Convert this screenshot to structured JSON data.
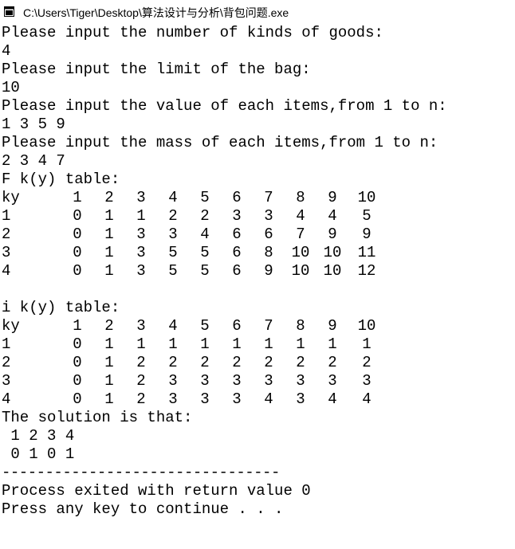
{
  "window": {
    "title": "C:\\Users\\Tiger\\Desktop\\算法设计与分析\\背包问题.exe"
  },
  "console": {
    "prompt_kinds": "Please input the number of kinds of goods:",
    "input_kinds": "4",
    "prompt_limit": "Please input the limit of the bag:",
    "input_limit": "10",
    "prompt_value": "Please input the value of each items,from 1 to n:",
    "input_value": "1 3 5 9",
    "prompt_mass": "Please input the mass of each items,from 1 to n:",
    "input_mass": "2 3 4 7",
    "fk_title": "F k(y) table:",
    "fk_table": {
      "header_label": "ky",
      "columns": [
        "1",
        "2",
        "3",
        "4",
        "5",
        "6",
        "7",
        "8",
        "9",
        "10"
      ],
      "rows": [
        {
          "label": "1",
          "cells": [
            "0",
            "1",
            "1",
            "2",
            "2",
            "3",
            "3",
            "4",
            "4",
            "5"
          ]
        },
        {
          "label": "2",
          "cells": [
            "0",
            "1",
            "3",
            "3",
            "4",
            "6",
            "6",
            "7",
            "9",
            "9"
          ]
        },
        {
          "label": "3",
          "cells": [
            "0",
            "1",
            "3",
            "5",
            "5",
            "6",
            "8",
            "10",
            "10",
            "11"
          ]
        },
        {
          "label": "4",
          "cells": [
            "0",
            "1",
            "3",
            "5",
            "5",
            "6",
            "9",
            "10",
            "10",
            "12"
          ]
        }
      ]
    },
    "ik_title": "i k(y) table:",
    "ik_table": {
      "header_label": "ky",
      "columns": [
        "1",
        "2",
        "3",
        "4",
        "5",
        "6",
        "7",
        "8",
        "9",
        "10"
      ],
      "rows": [
        {
          "label": "1",
          "cells": [
            "0",
            "1",
            "1",
            "1",
            "1",
            "1",
            "1",
            "1",
            "1",
            "1"
          ]
        },
        {
          "label": "2",
          "cells": [
            "0",
            "1",
            "2",
            "2",
            "2",
            "2",
            "2",
            "2",
            "2",
            "2"
          ]
        },
        {
          "label": "3",
          "cells": [
            "0",
            "1",
            "2",
            "3",
            "3",
            "3",
            "3",
            "3",
            "3",
            "3"
          ]
        },
        {
          "label": "4",
          "cells": [
            "0",
            "1",
            "2",
            "3",
            "3",
            "3",
            "4",
            "3",
            "4",
            "4"
          ]
        }
      ]
    },
    "solution_title": "The solution is that:",
    "solution_items": " 1 2 3 4",
    "solution_choice": " 0 1 0 1",
    "separator": "--------------------------------",
    "exit_message": "Process exited with return value 0",
    "continue_message": "Press any key to continue . . ."
  }
}
